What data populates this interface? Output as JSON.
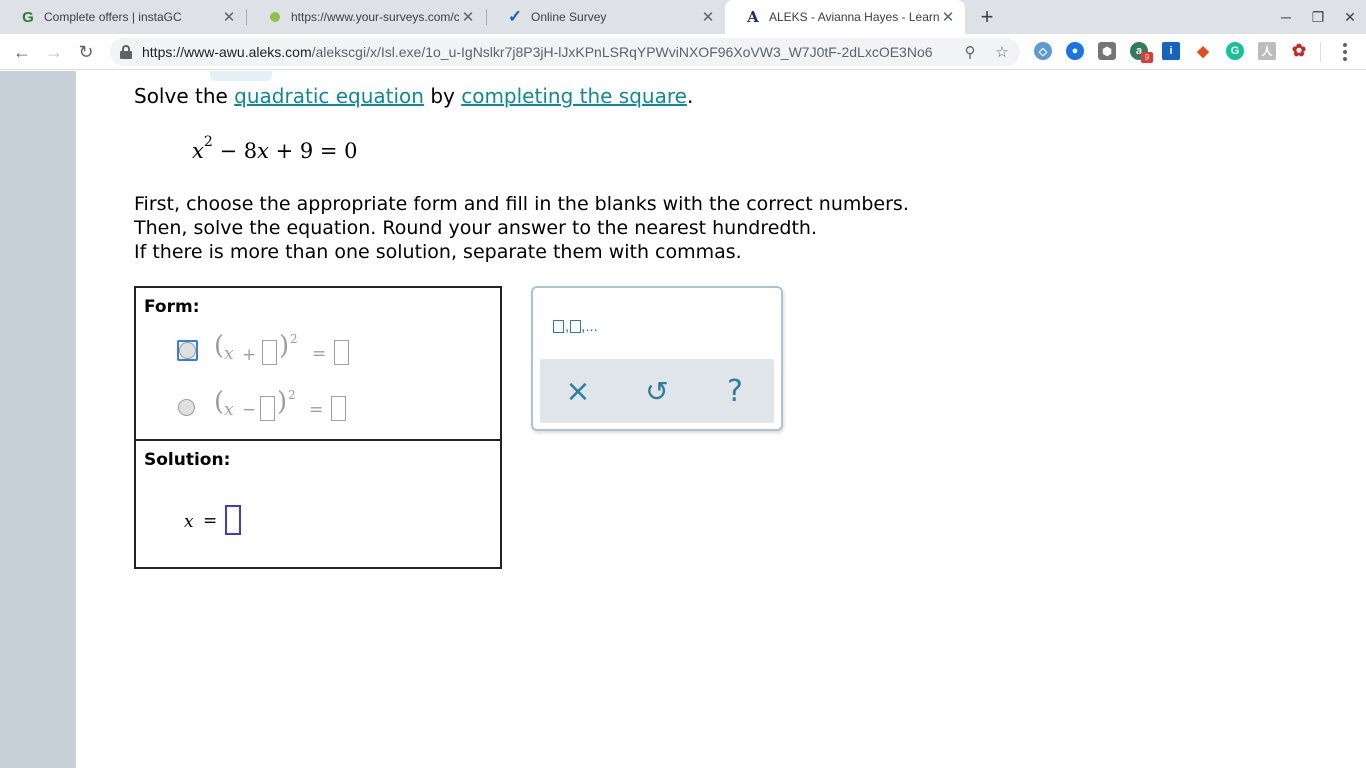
{
  "browser": {
    "tabs": [
      {
        "title": "Complete offers | instaGC",
        "favicon": "instagc-g-icon"
      },
      {
        "title": "https://www.your-surveys.com/c",
        "favicon": "survey-dot-icon"
      },
      {
        "title": "Online Survey",
        "favicon": "checkmark-icon"
      },
      {
        "title": "ALEKS - Avianna Hayes - Learn",
        "favicon": "aleks-a-icon"
      }
    ],
    "url_host": "https://www-awu.aleks.com",
    "url_path": "/alekscgi/x/Isl.exe/1o_u-IgNslkr7j8P3jH-lJxKPnLSRqYPWviNXOF96XoVW3_W7J0tF-2dLxcOE3No6...",
    "extension_badge": "9"
  },
  "problem": {
    "prefix": "Solve the ",
    "link1": "quadratic equation",
    "middle": " by ",
    "link2": "completing the square",
    "suffix": ".",
    "equation": {
      "var": "x",
      "exp": "2",
      "rest": " − 8",
      "var2": "x",
      "tail": " + 9 = 0"
    },
    "instructions": [
      "First, choose the appropriate form and fill in the blanks with the correct numbers.",
      "Then, solve the equation. Round your answer to the nearest hundredth.",
      "If there is more than one solution, separate them with commas."
    ]
  },
  "answer": {
    "form_heading": "Form:",
    "solution_heading": "Solution:",
    "form1": {
      "var": "x",
      "op": "+",
      "exp": "2",
      "eq": "="
    },
    "form2": {
      "var": "x",
      "op": "−",
      "exp": "2",
      "eq": "="
    },
    "solution_var": "x",
    "solution_eq": "="
  },
  "keypad": {
    "list_label": ",...",
    "clear_glyph": "×",
    "undo_glyph": "↺",
    "help_glyph": "?"
  }
}
